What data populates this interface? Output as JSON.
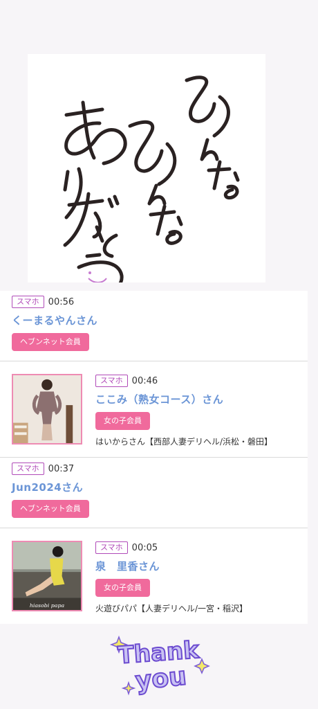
{
  "hero": {
    "calligraphy": "みんなみんなありがとう"
  },
  "entries": [
    {
      "device": "スマホ",
      "time": "00:56",
      "name": "くーまるやんさん",
      "member_type": "ヘブンネット会員"
    },
    {
      "device": "スマホ",
      "time": "00:46",
      "name": "ここみ（熟女コース）さん",
      "member_type": "女の子会員",
      "shop": "はいからさん【西部人妻デリヘル/浜松・磐田】"
    },
    {
      "device": "スマホ",
      "time": "00:37",
      "name": "Jun2024さん",
      "member_type": "ヘブンネット会員"
    },
    {
      "device": "スマホ",
      "time": "00:05",
      "name": "泉　里香さん",
      "member_type": "女の子会員",
      "shop": "火遊びパパ【人妻デリヘル/一宮・稲沢】"
    }
  ],
  "photo_watermark": "hiasobi papa",
  "thanks_sticker": {
    "line1": "Thank",
    "line2": "you"
  },
  "colors": {
    "accent_pink": "#f06a9c",
    "name_blue": "#6b95d6",
    "device_purple": "#b04ab8"
  }
}
